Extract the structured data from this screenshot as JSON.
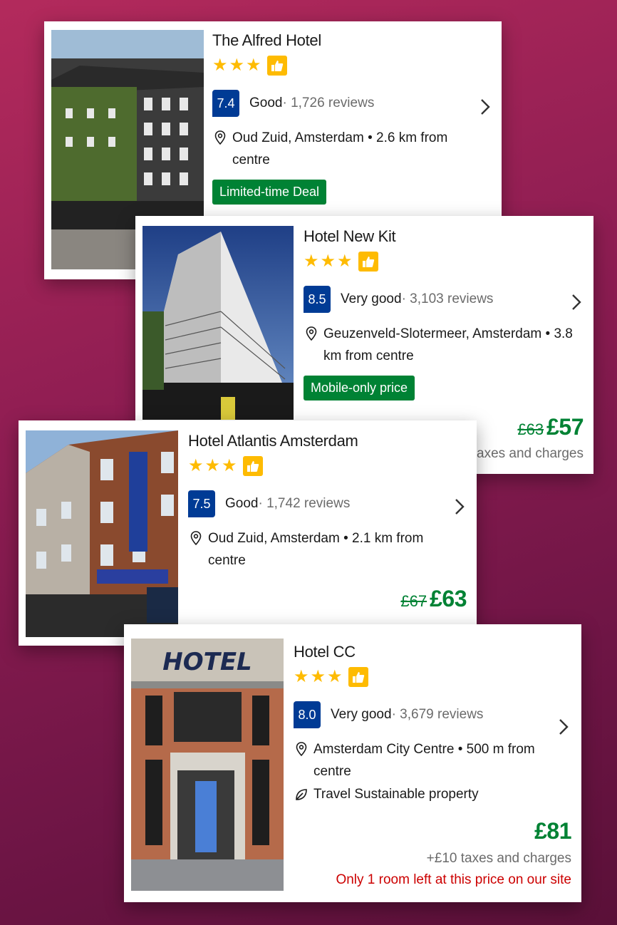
{
  "colors": {
    "accent": "#003b95",
    "deal_green": "#008234",
    "star": "#febb02",
    "warning": "#cc0000"
  },
  "hotels": [
    {
      "name": "The Alfred Hotel",
      "stars": 3,
      "score": "7.4",
      "rating_label": "Good",
      "reviews": " · 1,726 reviews",
      "location": "Oud Zuid, Amsterdam • 2.6 km from centre",
      "badge": "Limited-time Deal"
    },
    {
      "name": "Hotel New Kit",
      "stars": 3,
      "score": "8.5",
      "rating_label": "Very good",
      "reviews": " · 3,103 reviews",
      "location": "Geuzenveld-Slotermeer, Amsterdam • 3.8 km from centre",
      "badge": "Mobile-only price",
      "old_price": "£63",
      "price": "£57",
      "taxes": "axes and charges"
    },
    {
      "name": "Hotel Atlantis Amsterdam",
      "stars": 3,
      "score": "7.5",
      "rating_label": "Good",
      "reviews": " · 1,742 reviews",
      "location": "Oud Zuid, Amsterdam • 2.1 km from centre",
      "old_price": "£67",
      "price": "£63"
    },
    {
      "name": "Hotel CC",
      "stars": 3,
      "score": "8.0",
      "rating_label": "Very good",
      "reviews": " · 3,679 reviews",
      "location": "Amsterdam City Centre • 500 m from centre",
      "sustainable": "Travel Sustainable property",
      "price": "£81",
      "taxes": "+£10 taxes and charges",
      "warning": "Only 1 room left at this price on our site",
      "sign_text": "HOTEL"
    }
  ]
}
